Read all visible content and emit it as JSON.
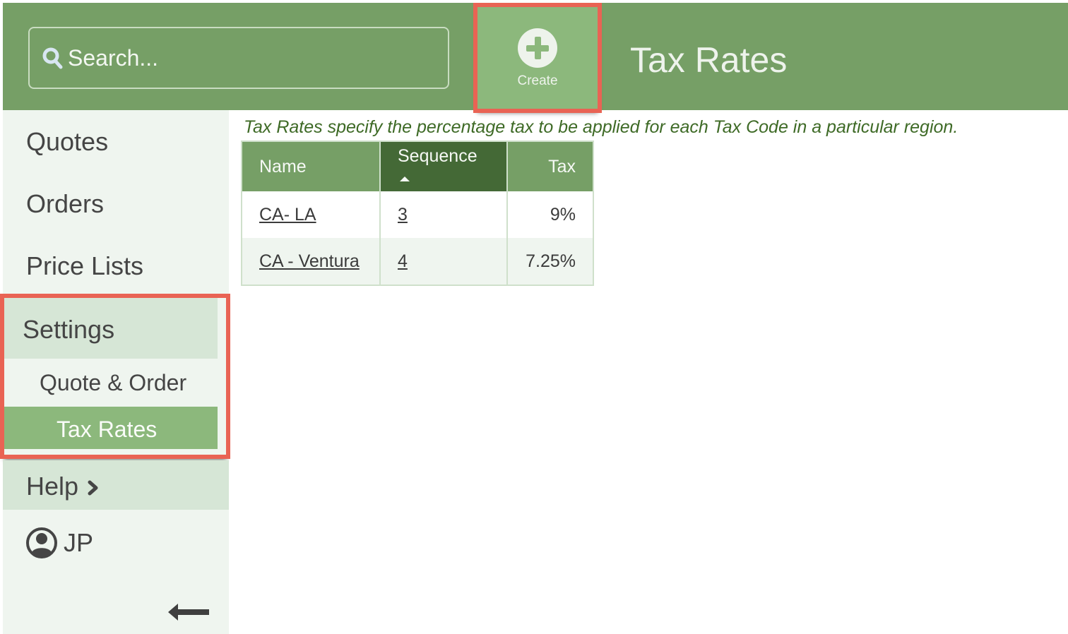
{
  "header": {
    "search_placeholder": "Search...",
    "create_label": "Create",
    "page_title": "Tax Rates"
  },
  "sidebar": {
    "items": [
      {
        "label": "Quotes"
      },
      {
        "label": "Orders"
      },
      {
        "label": "Price Lists"
      }
    ],
    "settings": {
      "label": "Settings",
      "children": [
        {
          "label": "Quote & Order",
          "active": false
        },
        {
          "label": "Tax Rates",
          "active": true
        }
      ]
    },
    "help_label": "Help",
    "user_initials": "JP"
  },
  "main": {
    "description": "Tax Rates specify the percentage tax to be applied for each Tax Code in a particular region.",
    "table": {
      "columns": [
        "Name",
        "Sequence",
        "Tax"
      ],
      "sorted_column": "Sequence",
      "sort_direction": "ascending",
      "rows": [
        {
          "name": "CA- LA",
          "sequence": "3",
          "tax": "9%"
        },
        {
          "name": "CA - Ventura",
          "sequence": "4",
          "tax": "7.25%"
        }
      ]
    }
  },
  "colors": {
    "header_green": "#769f66",
    "accent_green": "#8cb87c",
    "sorted_header": "#446936",
    "highlight_red": "#e96354",
    "description_green": "#3e6a26"
  }
}
